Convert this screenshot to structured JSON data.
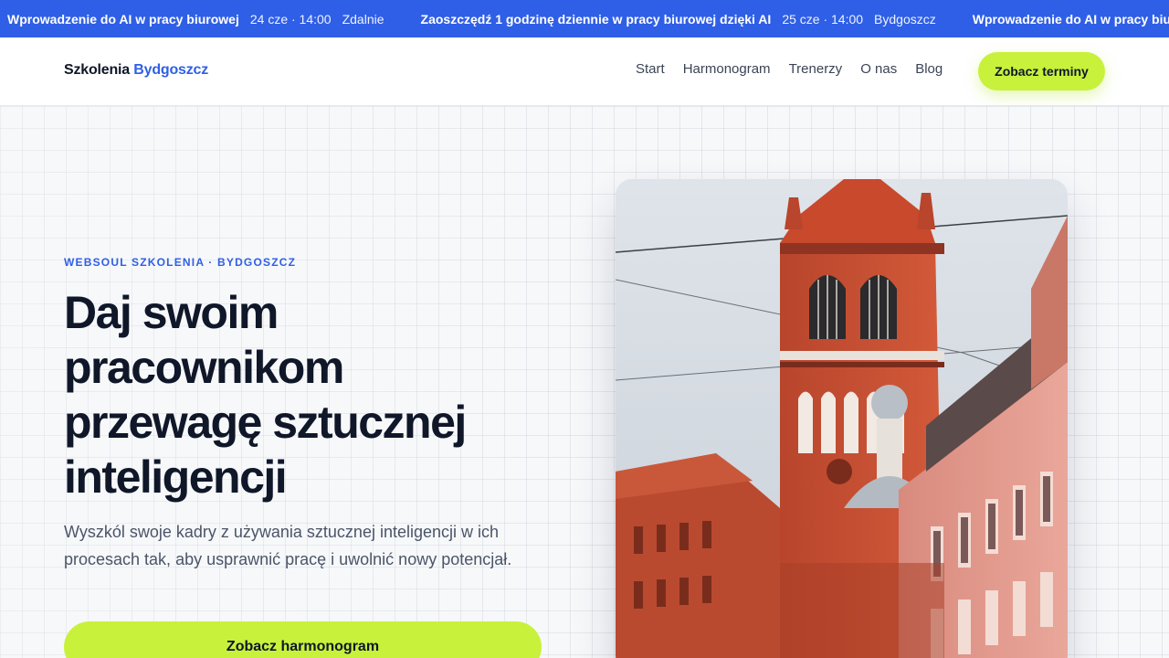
{
  "ticker": {
    "items": [
      {
        "title": "Wprowadzenie do AI w pracy biurowej",
        "date": "24 cze · 14:00",
        "location": "Zdalnie"
      },
      {
        "title": "Zaoszczędź 1 godzinę dziennie w pracy biurowej dzięki AI",
        "date": "25 cze · 14:00",
        "location": "Bydgoszcz"
      },
      {
        "title": "Wprowadzenie do AI w pracy biurowej",
        "date": "",
        "location": ""
      }
    ]
  },
  "header": {
    "logo_main": "Szkolenia",
    "logo_accent": "Bydgoszcz",
    "nav": [
      "Start",
      "Harmonogram",
      "Trenerzy",
      "O nas",
      "Blog"
    ],
    "cta_label": "Zobacz terminy"
  },
  "hero": {
    "eyebrow": "WEBSOUL SZKOLENIA · BYDGOSZCZ",
    "headline_lines": [
      "Daj swoim",
      "pracownikom",
      "przewagę sztucznej",
      "inteligencji"
    ],
    "lead": "Wyszkól swoje kadry z używania sztucznej inteligencji w ich procesach tak, aby usprawnić pracę i uwolnić nowy potencjał.",
    "button_label": "Zobacz harmonogram"
  },
  "colors": {
    "brand_blue": "#2f5fe6",
    "accent_lime": "#c8f13c",
    "ink": "#0f1729"
  }
}
